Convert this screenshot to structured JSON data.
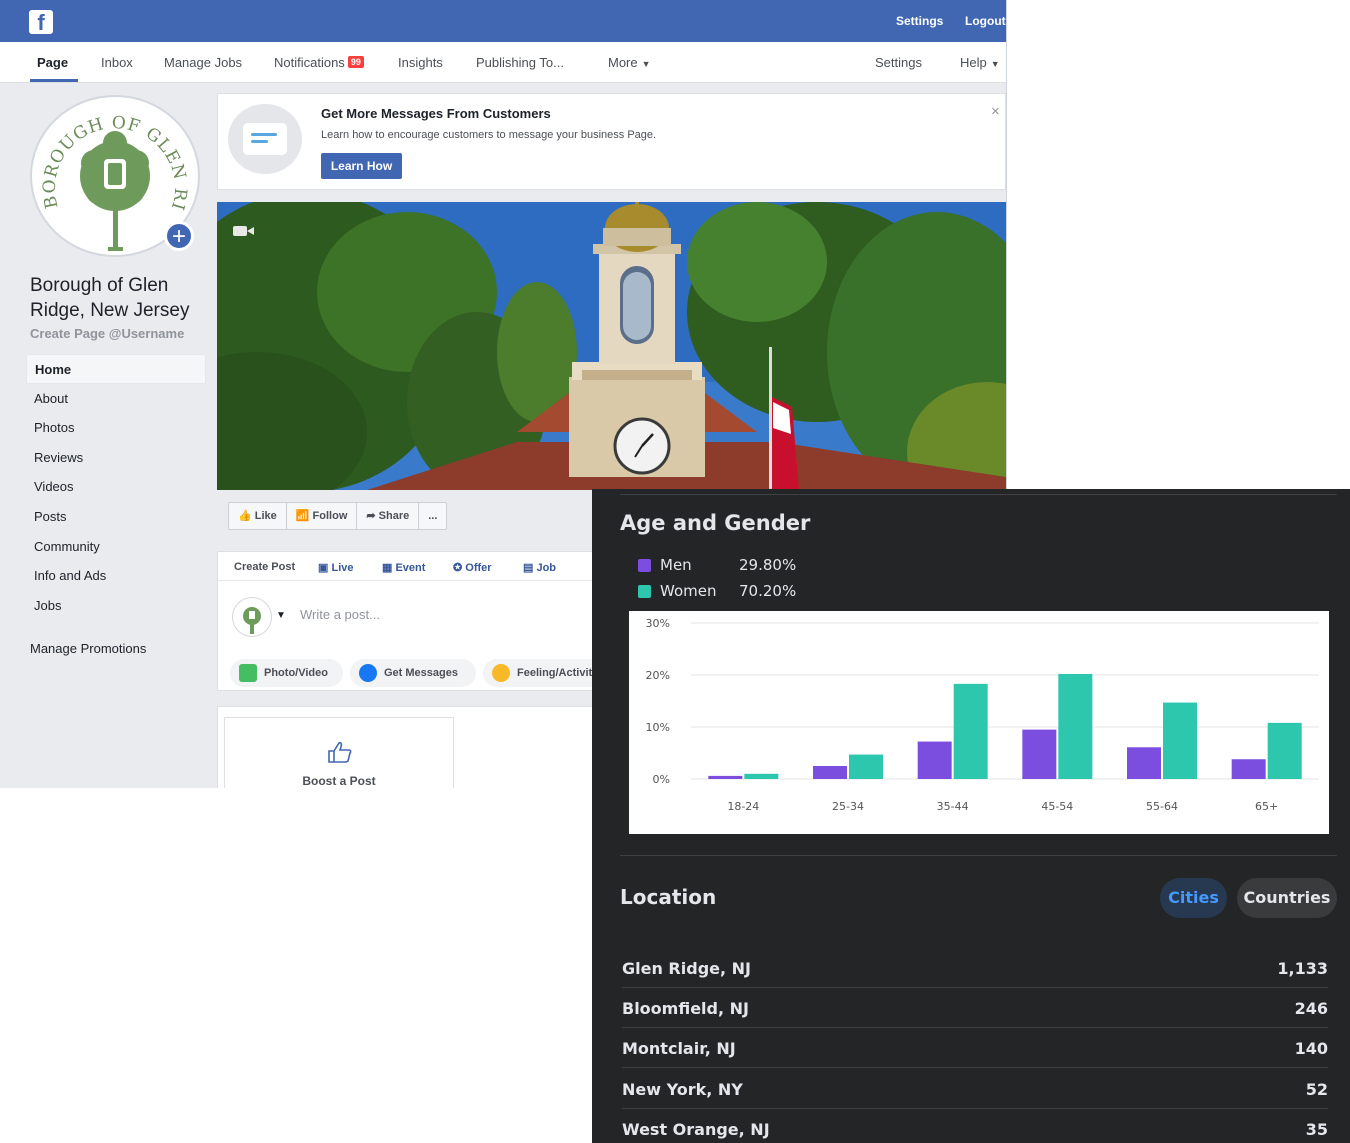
{
  "facebook": {
    "top_links": {
      "settings": "Settings",
      "logout": "Logout"
    },
    "tabs": [
      {
        "label": "Page",
        "active": true
      },
      {
        "label": "Inbox"
      },
      {
        "label": "Manage Jobs"
      },
      {
        "label": "Notifications",
        "badge": "99"
      },
      {
        "label": "Insights"
      },
      {
        "label": "Publishing To..."
      },
      {
        "label": "More"
      }
    ],
    "tabs_right": {
      "settings": "Settings",
      "help": "Help"
    },
    "page_name": "Borough of Glen Ridge, New Jersey",
    "username_link": "Create Page @Username",
    "logo_text": "BOROUGH OF GLEN RIDGE, NEW JERSEY",
    "sidebar": [
      {
        "label": "Home",
        "active": true
      },
      {
        "label": "About"
      },
      {
        "label": "Photos"
      },
      {
        "label": "Reviews"
      },
      {
        "label": "Videos"
      },
      {
        "label": "Posts"
      },
      {
        "label": "Community"
      },
      {
        "label": "Info and Ads"
      },
      {
        "label": "Jobs"
      }
    ],
    "manage_promotions": "Manage Promotions",
    "banner": {
      "title": "Get More Messages From Customers",
      "subtitle": "Learn how to encourage customers to message your business Page.",
      "button": "Learn How"
    },
    "actions": [
      "Like",
      "Follow",
      "Share",
      "..."
    ],
    "create_post": {
      "tabs": [
        "Create Post",
        "Live",
        "Event",
        "Offer",
        "Job"
      ],
      "placeholder": "Write a post...",
      "pills": [
        "Photo/Video",
        "Get Messages",
        "Feeling/Activit"
      ]
    },
    "boost": "Boost a Post"
  },
  "insights": {
    "age_gender": {
      "title": "Age and Gender",
      "legend": [
        {
          "name": "Men",
          "value": "29.80%",
          "color": "#7b4ee0"
        },
        {
          "name": "Women",
          "value": "70.20%",
          "color": "#2dc7ae"
        }
      ]
    },
    "location": {
      "title": "Location",
      "tabs": [
        {
          "label": "Cities",
          "active": true
        },
        {
          "label": "Countries"
        }
      ],
      "rows": [
        {
          "city": "Glen Ridge, NJ",
          "count": "1,133"
        },
        {
          "city": "Bloomfield, NJ",
          "count": "246"
        },
        {
          "city": "Montclair, NJ",
          "count": "140"
        },
        {
          "city": "New York, NY",
          "count": "52"
        },
        {
          "city": "West Orange, NJ",
          "count": "35"
        }
      ]
    }
  },
  "chart_data": {
    "type": "bar",
    "categories": [
      "18-24",
      "25-34",
      "35-44",
      "45-54",
      "55-64",
      "65+"
    ],
    "series": [
      {
        "name": "Men",
        "color": "#7b4ee0",
        "values": [
          0.6,
          2.5,
          7.2,
          9.5,
          6.1,
          3.8
        ]
      },
      {
        "name": "Women",
        "color": "#2dc7ae",
        "values": [
          1.0,
          4.7,
          18.3,
          20.2,
          14.7,
          10.8
        ]
      }
    ],
    "yticks": [
      "30%",
      "20%",
      "10%",
      "0%"
    ],
    "ylim": [
      0,
      30
    ],
    "grid": true
  }
}
